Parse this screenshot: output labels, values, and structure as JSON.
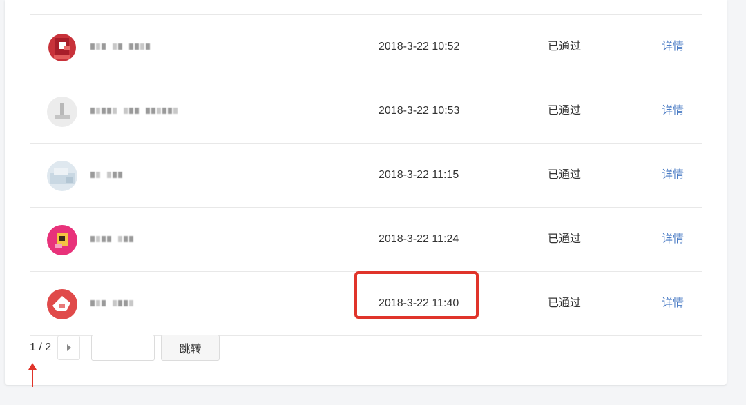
{
  "records": [
    {
      "avatar": "avatar-red-square",
      "time": "2018-3-22 10:52",
      "status": "已通过",
      "action": "详情",
      "nick_blocks": [
        3,
        2,
        4
      ]
    },
    {
      "avatar": "avatar-default-gray",
      "time": "2018-3-22 10:53",
      "status": "已通过",
      "action": "详情",
      "nick_blocks": [
        5,
        3,
        6
      ]
    },
    {
      "avatar": "avatar-light-blue",
      "time": "2018-3-22 11:15",
      "status": "已通过",
      "action": "详情",
      "nick_blocks": [
        2,
        3
      ]
    },
    {
      "avatar": "avatar-pink-yellow",
      "time": "2018-3-22 11:24",
      "status": "已通过",
      "action": "详情",
      "nick_blocks": [
        4,
        3
      ]
    },
    {
      "avatar": "avatar-red-white",
      "time": "2018-3-22 11:40",
      "status": "已通过",
      "action": "详情",
      "nick_blocks": [
        3,
        4
      ]
    }
  ],
  "pagination": {
    "indicator": "1 / 2",
    "jump_label": "跳转",
    "input_value": "",
    "next_icon": "caret-right-icon"
  },
  "annotation": {
    "highlight_color": "#e0342a",
    "highlighted_row": 4
  },
  "colors": {
    "link": "#4a7bc4",
    "text": "#333333",
    "divider": "#e8e8e8",
    "background": "#f4f5f7"
  }
}
